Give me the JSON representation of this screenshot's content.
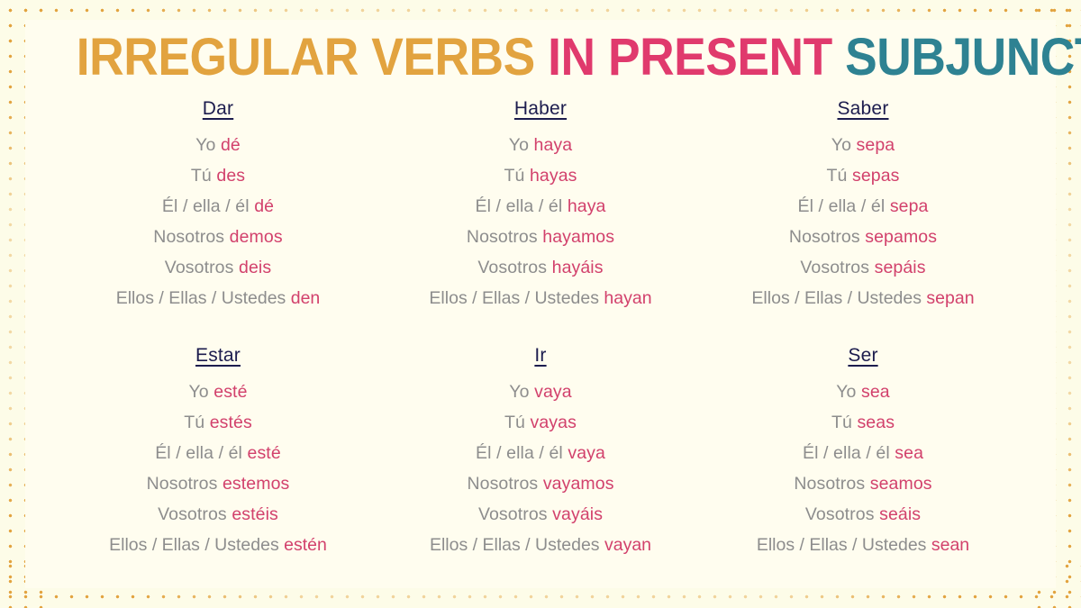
{
  "title": {
    "segment_1": "IRREGULAR VERBS",
    "segment_2": "IN PRESENT",
    "segment_3": "SUBJUNCTIVE",
    "color_1": "#e2a33f",
    "color_2": "#e03a6d",
    "color_3": "#2e8292"
  },
  "theme": {
    "background": "#fffdef",
    "dot_color": "#e2a33f",
    "pronoun_color": "#8d8d8d",
    "form_color": "#d2416c",
    "heading_color": "#1c1c4e"
  },
  "pronouns": [
    "Yo",
    "Tú",
    "Él / ella / él",
    "Nosotros",
    "Vosotros",
    "Ellos / Ellas / Ustedes"
  ],
  "verbs": [
    {
      "name": "Dar",
      "forms": [
        "dé",
        "des",
        "dé",
        "demos",
        "deis",
        "den"
      ]
    },
    {
      "name": "Haber",
      "forms": [
        "haya",
        "hayas",
        "haya",
        "hayamos",
        "hayáis",
        "hayan"
      ]
    },
    {
      "name": "Saber",
      "forms": [
        "sepa",
        "sepas",
        "sepa",
        "sepamos",
        "sepáis",
        "sepan"
      ]
    },
    {
      "name": "Estar",
      "forms": [
        "esté",
        "estés",
        "esté",
        "estemos",
        "estéis",
        "estén"
      ]
    },
    {
      "name": "Ir",
      "forms": [
        "vaya",
        "vayas",
        "vaya",
        "vayamos",
        "vayáis",
        "vayan"
      ]
    },
    {
      "name": "Ser",
      "forms": [
        "sea",
        "seas",
        "sea",
        "seamos",
        "seáis",
        "sean"
      ]
    }
  ]
}
